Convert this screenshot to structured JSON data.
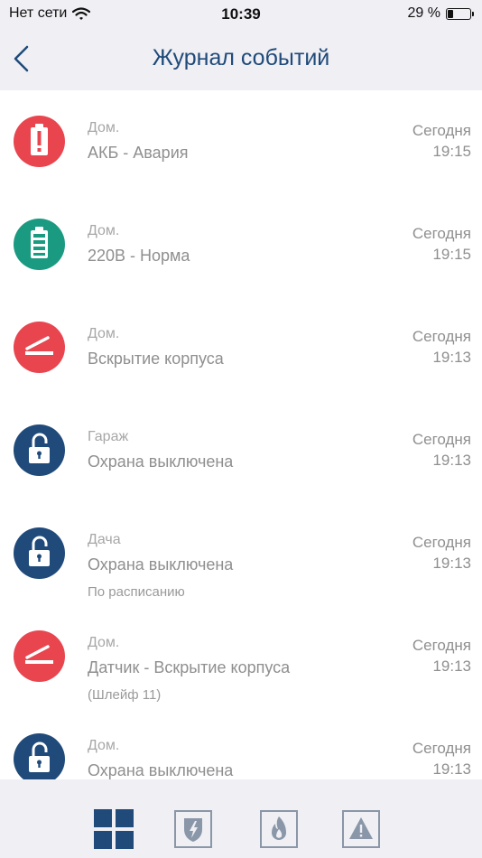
{
  "status_bar": {
    "carrier": "Нет сети",
    "time": "10:39",
    "battery": "29 %",
    "battery_level": 0.29
  },
  "header": {
    "title": "Журнал событий"
  },
  "events": [
    {
      "place": "Дом.",
      "message": "АКБ - Авария",
      "extra": "",
      "day": "Сегодня",
      "time": "19:15",
      "icon": "battery-alarm-icon",
      "color": "#e8454f"
    },
    {
      "place": "Дом.",
      "message": "220В - Норма",
      "extra": "",
      "day": "Сегодня",
      "time": "19:15",
      "icon": "battery-full-icon",
      "color": "#1a9a80"
    },
    {
      "place": "Дом.",
      "message": "Вскрытие корпуса",
      "extra": "",
      "day": "Сегодня",
      "time": "19:13",
      "icon": "tamper-icon",
      "color": "#e8454f"
    },
    {
      "place": "Гараж",
      "message": "Охрана выключена",
      "extra": "",
      "day": "Сегодня",
      "time": "19:13",
      "icon": "unlock-icon",
      "color": "#1f4a7a"
    },
    {
      "place": "Дача",
      "message": "Охрана выключена",
      "extra": "По расписанию",
      "day": "Сегодня",
      "time": "19:13",
      "icon": "unlock-icon",
      "color": "#1f4a7a"
    },
    {
      "place": "Дом.",
      "message": "Датчик - Вскрытие корпуса",
      "extra": "(Шлейф 11)",
      "day": "Сегодня",
      "time": "19:13",
      "icon": "tamper-icon",
      "color": "#e8454f"
    },
    {
      "place": "Дом.",
      "message": "Охрана выключена",
      "extra": "",
      "day": "Сегодня",
      "time": "19:13",
      "icon": "unlock-icon",
      "color": "#1f4a7a"
    }
  ],
  "tabs": [
    {
      "icon": "grid-icon",
      "active": true
    },
    {
      "icon": "security-shield-icon",
      "active": false
    },
    {
      "icon": "fire-icon",
      "active": false
    },
    {
      "icon": "warning-icon",
      "active": false
    }
  ],
  "colors": {
    "accent": "#1f4a7a",
    "alarm": "#e8454f",
    "norm": "#1a9a80",
    "inactive": "#8a97a8"
  }
}
